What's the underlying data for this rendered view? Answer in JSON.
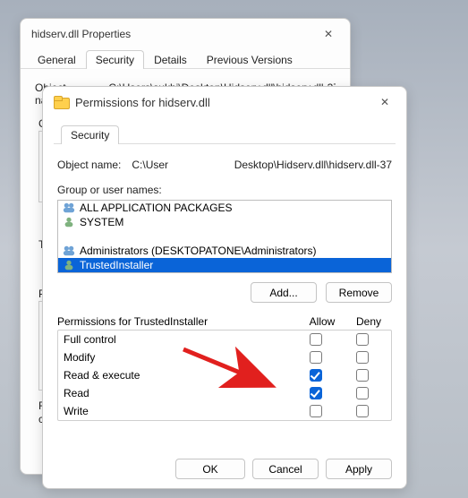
{
  "back_window": {
    "title": "hidserv.dll Properties",
    "tabs": [
      "General",
      "Security",
      "Details",
      "Previous Versions"
    ],
    "active_tab": 1,
    "obj_label": "Object name:",
    "obj_value_fragment": "C:\\Users\\sukhi\\Desktop\\Hidserv.dll\\hidserv.dll-37",
    "group_label_short": "Gro",
    "to_label": "To",
    "pe_label": "Pe",
    "for_label": "Fo",
    "cli_label": "cli"
  },
  "front_window": {
    "title": "Permissions for hidserv.dll",
    "tab": "Security",
    "obj_label": "Object name:",
    "obj_path_left": "C:\\User",
    "obj_path_right": "Desktop\\Hidserv.dll\\hidserv.dll-37",
    "group_section": "Group or user names:",
    "principals": [
      {
        "icon": "group",
        "label": "ALL APPLICATION PACKAGES"
      },
      {
        "icon": "user",
        "label": "SYSTEM"
      },
      {
        "icon": "group",
        "label": "Administrators (DESKTOPATONE\\Administrators)"
      },
      {
        "icon": "user",
        "label": "TrustedInstaller",
        "selected": true
      }
    ],
    "add_btn": "Add...",
    "remove_btn": "Remove",
    "perm_heading_left": "Permissions for TrustedInstaller",
    "allow": "Allow",
    "deny": "Deny",
    "rows": [
      {
        "label": "Full control",
        "allow": false,
        "deny": false
      },
      {
        "label": "Modify",
        "allow": false,
        "deny": false
      },
      {
        "label": "Read & execute",
        "allow": true,
        "deny": false
      },
      {
        "label": "Read",
        "allow": true,
        "deny": false
      },
      {
        "label": "Write",
        "allow": false,
        "deny": false
      }
    ],
    "ok": "OK",
    "cancel": "Cancel",
    "apply": "Apply"
  }
}
